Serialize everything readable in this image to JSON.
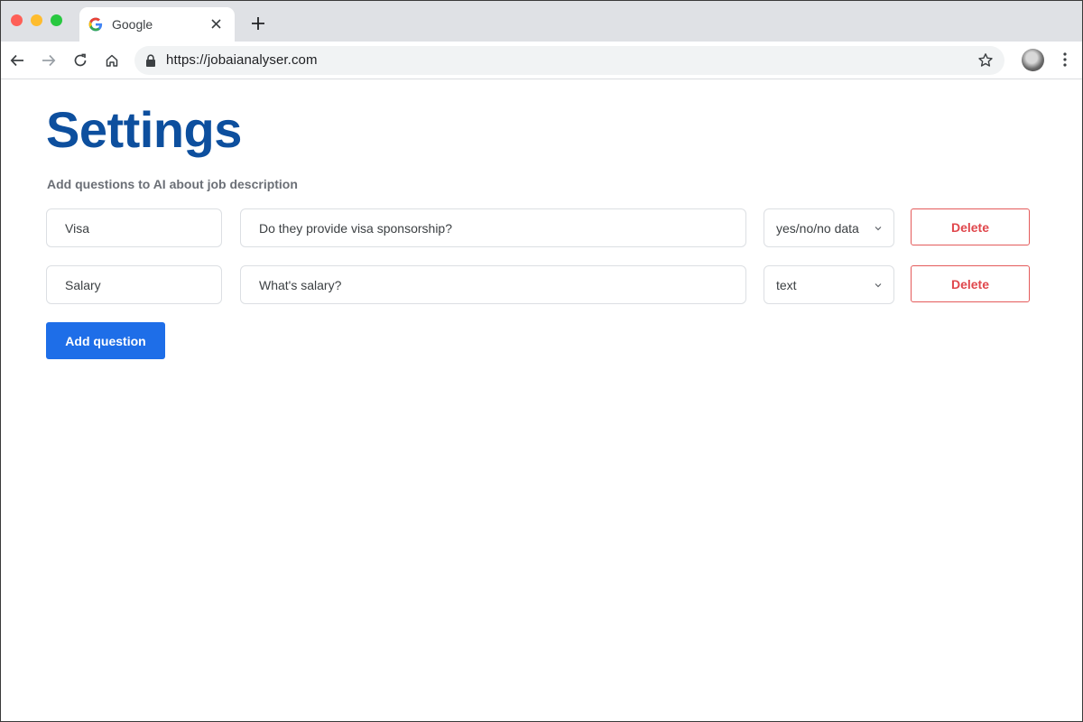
{
  "browser": {
    "tab_title": "Google",
    "url": "https://jobaianalyser.com",
    "icons": {
      "favicon": "google-g-icon",
      "close": "close-icon",
      "new_tab": "plus-icon",
      "back": "back-arrow-icon",
      "forward": "forward-arrow-icon",
      "reload": "reload-icon",
      "home": "home-icon",
      "lock": "lock-icon",
      "bookmark": "star-icon",
      "menu": "kebab-menu-icon"
    }
  },
  "page": {
    "title": "Settings",
    "subtitle": "Add questions to AI about job description",
    "questions": [
      {
        "name": "Visa",
        "question": "Do they provide visa sponsorship?",
        "type": "yes/no/no data",
        "delete_label": "Delete"
      },
      {
        "name": "Salary",
        "question": "What's salary?",
        "type": "text",
        "delete_label": "Delete"
      }
    ],
    "add_button_label": "Add question"
  },
  "colors": {
    "title": "#0d4f9e",
    "primary_button": "#1e6ee8",
    "delete": "#e0474c"
  }
}
